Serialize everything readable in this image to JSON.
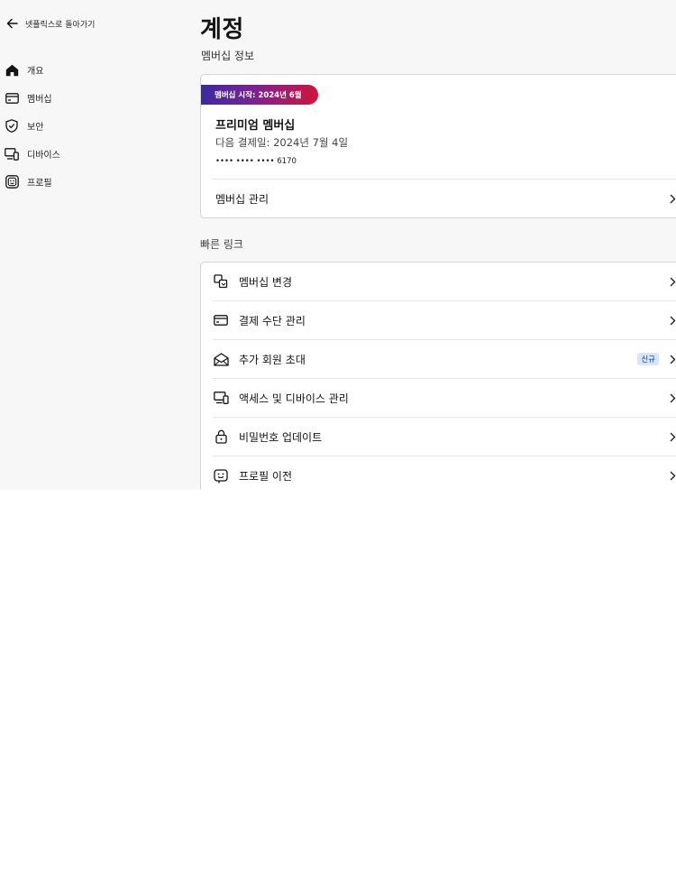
{
  "sidebar": {
    "back_label": "넷플릭스로 돌아가기",
    "items": [
      {
        "label": "개요",
        "icon": "home-icon"
      },
      {
        "label": "멤버십",
        "icon": "card-icon"
      },
      {
        "label": "보안",
        "icon": "shield-icon"
      },
      {
        "label": "디바이스",
        "icon": "devices-icon"
      },
      {
        "label": "프로필",
        "icon": "profile-icon"
      }
    ]
  },
  "main": {
    "title": "계정",
    "membership_section_title": "멤버십 정보",
    "membership": {
      "badge": "멤버십 시작: 2024년 6월",
      "plan": "프리미엄 멤버십",
      "next_payment": "다음 결제일: 2024년 7월 4일",
      "card_number": "•••• •••• •••• 6170",
      "manage_label": "멤버십 관리"
    },
    "quick_links_title": "빠른 링크",
    "quick_links": [
      {
        "label": "멤버십 변경",
        "icon": "change-plan-icon"
      },
      {
        "label": "결제 수단 관리",
        "icon": "payment-card-icon"
      },
      {
        "label": "추가 회원 초대",
        "icon": "invite-mail-icon",
        "badge": "신규"
      },
      {
        "label": "액세스 및 디바이스 관리",
        "icon": "devices-icon"
      },
      {
        "label": "비밀번호 업데이트",
        "icon": "lock-icon"
      },
      {
        "label": "프로필 이전",
        "icon": "profile-transfer-icon"
      }
    ]
  },
  "colors": {
    "badge_gradient_start": "#3b2a9f",
    "badge_gradient_end": "#d1143a",
    "new_badge_bg": "#d7e6fb",
    "new_badge_text": "#0a3f8f"
  }
}
